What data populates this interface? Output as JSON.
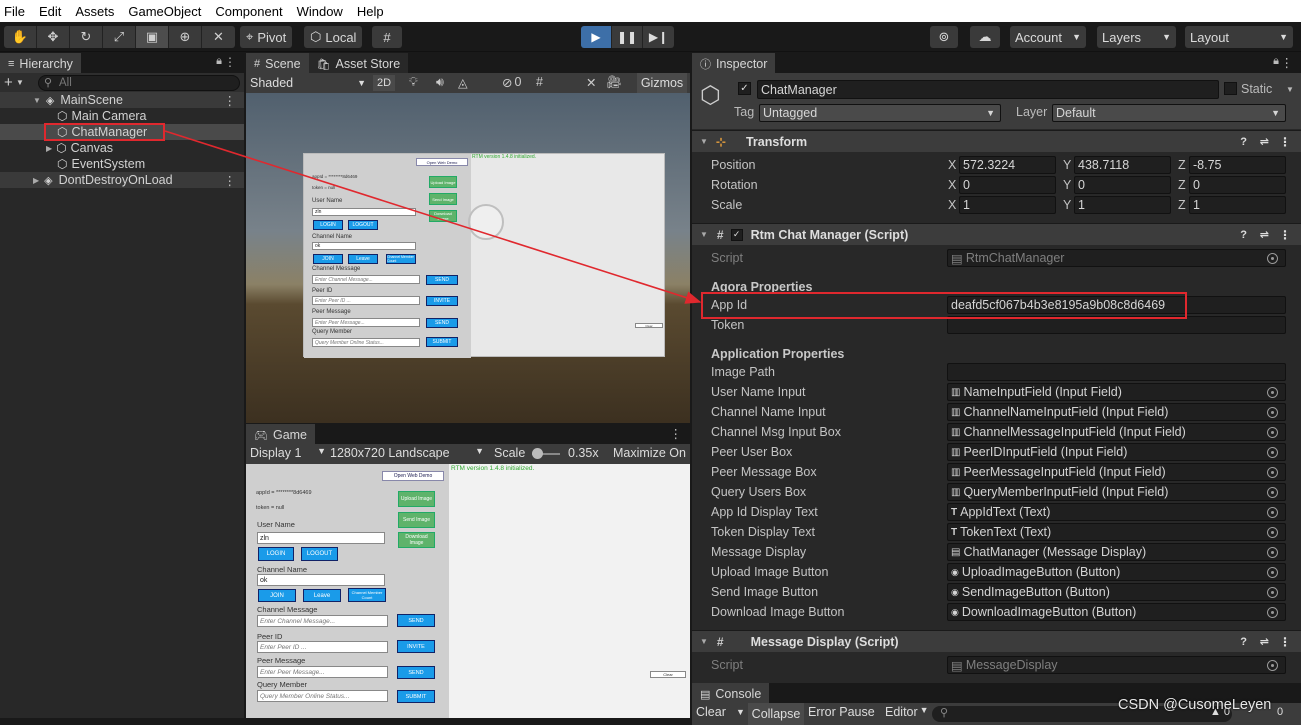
{
  "menu": [
    "File",
    "Edit",
    "Assets",
    "GameObject",
    "Component",
    "Window",
    "Help"
  ],
  "toolbar": {
    "pivot": "Pivot",
    "local": "Local",
    "account": "Account",
    "layers": "Layers",
    "layout": "Layout"
  },
  "hierarchy": {
    "tab": "Hierarchy",
    "search_placeholder": "All",
    "items": [
      {
        "label": "MainScene"
      },
      {
        "label": "Main Camera"
      },
      {
        "label": "ChatManager"
      },
      {
        "label": "Canvas"
      },
      {
        "label": "EventSystem"
      },
      {
        "label": "DontDestroyOnLoad"
      }
    ]
  },
  "scene": {
    "tab_scene": "Scene",
    "tab_store": "Asset Store",
    "shaded": "Shaded",
    "mode_2d": "2D",
    "gizmos": "Gizmos",
    "hidden_count": "0"
  },
  "game": {
    "tab": "Game",
    "display": "Display 1",
    "resolution": "1280x720 Landscape",
    "scale_label": "Scale",
    "scale_value": "0.35x",
    "maximize": "Maximize On",
    "ui": {
      "open_demo": "Open Web Demo",
      "rtm_status": "RTM version 1.4.8 initialized.",
      "appid": "appId = ********8d6469",
      "token": "token = null",
      "user_name": "User Name",
      "user_value": "zln",
      "login": "LOGIN",
      "logout": "LOGOUT",
      "channel_name": "Channel Name",
      "channel_value": "ok",
      "join": "JOIN",
      "leave": "Leave",
      "channel_count": "Channel Member Count",
      "channel_message": "Channel Message",
      "channel_msg_ph": "Enter Channel Message...",
      "send": "SEND",
      "peer_id": "Peer ID",
      "peer_id_ph": "Enter Peer ID ...",
      "invite": "INVITE",
      "peer_message": "Peer Message",
      "peer_msg_ph": "Enter Peer Message...",
      "query_member": "Query Member",
      "query_ph": "Query Member Online Status...",
      "submit": "SUBMIT",
      "upload": "Upload Image",
      "send_image": "Send Image",
      "download": "Download Image",
      "clear": "Clear"
    }
  },
  "inspector": {
    "tab": "Inspector",
    "object_name": "ChatManager",
    "static": "Static",
    "tag_label": "Tag",
    "tag_value": "Untagged",
    "layer_label": "Layer",
    "layer_value": "Default",
    "transform": {
      "title": "Transform",
      "position_label": "Position",
      "rotation_label": "Rotation",
      "scale_label": "Scale",
      "position": [
        "572.3224",
        "438.7118",
        "-8.75"
      ],
      "rotation": [
        "0",
        "0",
        "0"
      ],
      "scale": [
        "1",
        "1",
        "1"
      ]
    },
    "rtm": {
      "title": "Rtm Chat Manager (Script)",
      "script_label": "Script",
      "script_value": "RtmChatManager",
      "agora_header": "Agora Properties",
      "appid_label": "App Id",
      "appid_value": "deafd5cf067b4b3e8195a9b08c8d6469",
      "token_label": "Token",
      "token_value": "",
      "app_header": "Application Properties",
      "image_path_label": "Image Path",
      "image_path_value": "",
      "refs": [
        {
          "label": "User Name Input",
          "value": "NameInputField (Input Field)"
        },
        {
          "label": "Channel Name Input",
          "value": "ChannelNameInputField (Input Field)"
        },
        {
          "label": "Channel Msg Input Box",
          "value": "ChannelMessageInputField (Input Field)"
        },
        {
          "label": "Peer User Box",
          "value": "PeerIDInputField (Input Field)"
        },
        {
          "label": "Peer Message Box",
          "value": "PeerMessageInputField (Input Field)"
        },
        {
          "label": "Query Users Box",
          "value": "QueryMemberInputField (Input Field)"
        },
        {
          "label": "App Id Display Text",
          "value": "AppIdText (Text)"
        },
        {
          "label": "Token Display Text",
          "value": "TokenText (Text)"
        },
        {
          "label": "Message Display",
          "value": "ChatManager (Message Display)"
        },
        {
          "label": "Upload Image Button",
          "value": "UploadImageButton (Button)"
        },
        {
          "label": "Send Image Button",
          "value": "SendImageButton (Button)"
        },
        {
          "label": "Download Image Button",
          "value": "DownloadImageButton (Button)"
        }
      ]
    },
    "message_display": {
      "title": "Message Display (Script)",
      "script_label": "Script",
      "script_value": "MessageDisplay"
    }
  },
  "console": {
    "tab": "Console",
    "clear": "Clear",
    "collapse": "Collapse",
    "error_pause": "Error Pause",
    "editor": "Editor",
    "count_a": "0",
    "count_b": "0"
  },
  "watermark": "CSDN @CusomeLeyen",
  "colors": {
    "highlight": "#e0282e",
    "play_active": "#3d6fa8",
    "button_blue": "#1a9be9"
  }
}
